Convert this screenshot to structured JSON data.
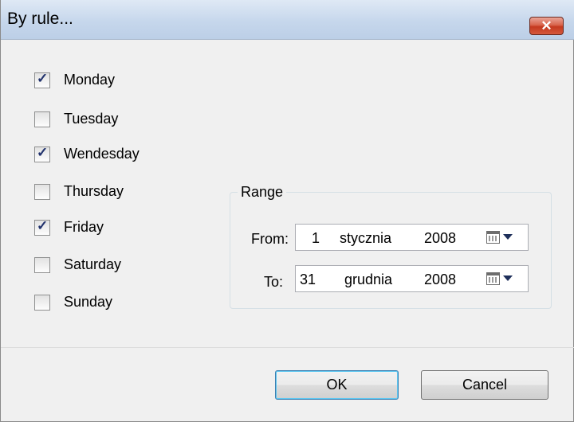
{
  "window": {
    "title": "By rule...",
    "close_glyph": "✕"
  },
  "days": [
    {
      "label": "Monday",
      "checked": true
    },
    {
      "label": "Tuesday",
      "checked": false
    },
    {
      "label": "Wendesday",
      "checked": true
    },
    {
      "label": "Thursday",
      "checked": false
    },
    {
      "label": "Friday",
      "checked": true
    },
    {
      "label": "Saturday",
      "checked": false
    },
    {
      "label": "Sunday",
      "checked": false
    }
  ],
  "range": {
    "title": "Range",
    "from": {
      "label": "From:",
      "day": "1",
      "month": "stycznia",
      "year": "2008"
    },
    "to": {
      "label": "To:",
      "day": "31",
      "month": "grudnia",
      "year": "2008"
    }
  },
  "buttons": {
    "ok": "OK",
    "cancel": "Cancel"
  },
  "icons": {
    "close": "close-icon",
    "checkmark": "checkmark-icon",
    "calendar": "calendar-icon",
    "dropdown": "chevron-down-icon"
  },
  "colors": {
    "title_bar": "#c6d7ec",
    "close_button": "#c4391f",
    "window_bg": "#f0f0f0",
    "check": "#21326d"
  }
}
